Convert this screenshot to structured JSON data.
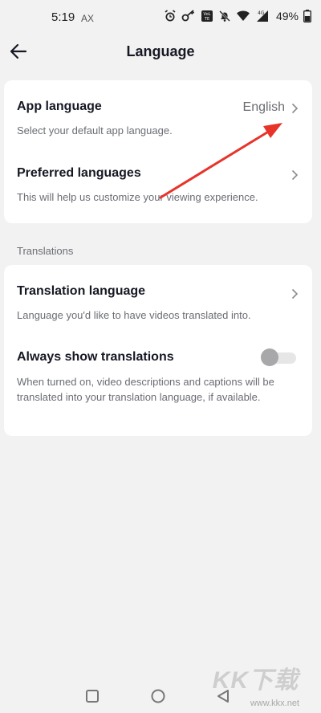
{
  "status_bar": {
    "time": "5:19",
    "carrier": "AX",
    "network": "4G",
    "battery": "49%",
    "icons": [
      "alarm-icon",
      "key-icon",
      "volte-icon",
      "mute-icon",
      "wifi-icon",
      "signal-icon",
      "battery-icon"
    ]
  },
  "header": {
    "title": "Language",
    "back_icon": "arrow-left-icon"
  },
  "section_1": {
    "rows": [
      {
        "title": "App language",
        "description": "Select your default app language.",
        "value": "English"
      },
      {
        "title": "Preferred languages",
        "description": "This will help us customize your viewing experience."
      }
    ]
  },
  "section_2": {
    "label": "Translations",
    "rows": [
      {
        "title": "Translation language",
        "description": "Language you'd like to have videos translated into."
      },
      {
        "title": "Always show translations",
        "description": "When turned on, video descriptions and captions will be translated into your translation language, if available.",
        "toggle_on": false
      }
    ]
  },
  "annotation": {
    "arrow_color": "#e8332a"
  },
  "watermark": {
    "brand": "KK下载",
    "url": "www.kkx.net"
  },
  "nav_bar": {
    "icons": [
      "recents-square-icon",
      "home-circle-icon",
      "back-triangle-icon"
    ]
  }
}
